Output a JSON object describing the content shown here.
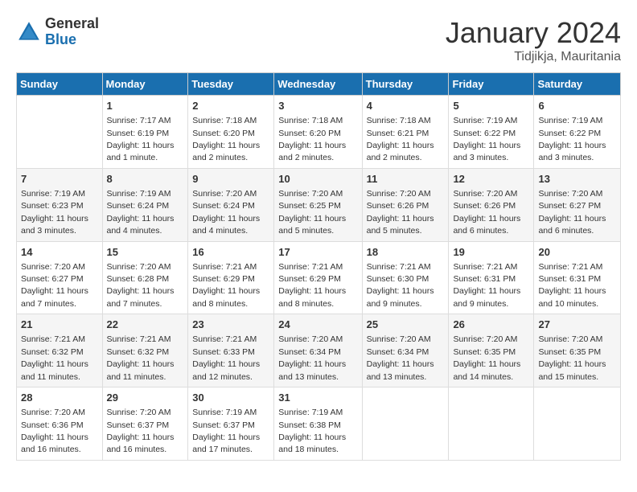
{
  "header": {
    "logo_general": "General",
    "logo_blue": "Blue",
    "month_year": "January 2024",
    "location": "Tidjikja, Mauritania"
  },
  "days_of_week": [
    "Sunday",
    "Monday",
    "Tuesday",
    "Wednesday",
    "Thursday",
    "Friday",
    "Saturday"
  ],
  "weeks": [
    [
      {
        "day": "",
        "sunrise": "",
        "sunset": "",
        "daylight": ""
      },
      {
        "day": "1",
        "sunrise": "Sunrise: 7:17 AM",
        "sunset": "Sunset: 6:19 PM",
        "daylight": "Daylight: 11 hours and 1 minute."
      },
      {
        "day": "2",
        "sunrise": "Sunrise: 7:18 AM",
        "sunset": "Sunset: 6:20 PM",
        "daylight": "Daylight: 11 hours and 2 minutes."
      },
      {
        "day": "3",
        "sunrise": "Sunrise: 7:18 AM",
        "sunset": "Sunset: 6:20 PM",
        "daylight": "Daylight: 11 hours and 2 minutes."
      },
      {
        "day": "4",
        "sunrise": "Sunrise: 7:18 AM",
        "sunset": "Sunset: 6:21 PM",
        "daylight": "Daylight: 11 hours and 2 minutes."
      },
      {
        "day": "5",
        "sunrise": "Sunrise: 7:19 AM",
        "sunset": "Sunset: 6:22 PM",
        "daylight": "Daylight: 11 hours and 3 minutes."
      },
      {
        "day": "6",
        "sunrise": "Sunrise: 7:19 AM",
        "sunset": "Sunset: 6:22 PM",
        "daylight": "Daylight: 11 hours and 3 minutes."
      }
    ],
    [
      {
        "day": "7",
        "sunrise": "Sunrise: 7:19 AM",
        "sunset": "Sunset: 6:23 PM",
        "daylight": "Daylight: 11 hours and 3 minutes."
      },
      {
        "day": "8",
        "sunrise": "Sunrise: 7:19 AM",
        "sunset": "Sunset: 6:24 PM",
        "daylight": "Daylight: 11 hours and 4 minutes."
      },
      {
        "day": "9",
        "sunrise": "Sunrise: 7:20 AM",
        "sunset": "Sunset: 6:24 PM",
        "daylight": "Daylight: 11 hours and 4 minutes."
      },
      {
        "day": "10",
        "sunrise": "Sunrise: 7:20 AM",
        "sunset": "Sunset: 6:25 PM",
        "daylight": "Daylight: 11 hours and 5 minutes."
      },
      {
        "day": "11",
        "sunrise": "Sunrise: 7:20 AM",
        "sunset": "Sunset: 6:26 PM",
        "daylight": "Daylight: 11 hours and 5 minutes."
      },
      {
        "day": "12",
        "sunrise": "Sunrise: 7:20 AM",
        "sunset": "Sunset: 6:26 PM",
        "daylight": "Daylight: 11 hours and 6 minutes."
      },
      {
        "day": "13",
        "sunrise": "Sunrise: 7:20 AM",
        "sunset": "Sunset: 6:27 PM",
        "daylight": "Daylight: 11 hours and 6 minutes."
      }
    ],
    [
      {
        "day": "14",
        "sunrise": "Sunrise: 7:20 AM",
        "sunset": "Sunset: 6:27 PM",
        "daylight": "Daylight: 11 hours and 7 minutes."
      },
      {
        "day": "15",
        "sunrise": "Sunrise: 7:20 AM",
        "sunset": "Sunset: 6:28 PM",
        "daylight": "Daylight: 11 hours and 7 minutes."
      },
      {
        "day": "16",
        "sunrise": "Sunrise: 7:21 AM",
        "sunset": "Sunset: 6:29 PM",
        "daylight": "Daylight: 11 hours and 8 minutes."
      },
      {
        "day": "17",
        "sunrise": "Sunrise: 7:21 AM",
        "sunset": "Sunset: 6:29 PM",
        "daylight": "Daylight: 11 hours and 8 minutes."
      },
      {
        "day": "18",
        "sunrise": "Sunrise: 7:21 AM",
        "sunset": "Sunset: 6:30 PM",
        "daylight": "Daylight: 11 hours and 9 minutes."
      },
      {
        "day": "19",
        "sunrise": "Sunrise: 7:21 AM",
        "sunset": "Sunset: 6:31 PM",
        "daylight": "Daylight: 11 hours and 9 minutes."
      },
      {
        "day": "20",
        "sunrise": "Sunrise: 7:21 AM",
        "sunset": "Sunset: 6:31 PM",
        "daylight": "Daylight: 11 hours and 10 minutes."
      }
    ],
    [
      {
        "day": "21",
        "sunrise": "Sunrise: 7:21 AM",
        "sunset": "Sunset: 6:32 PM",
        "daylight": "Daylight: 11 hours and 11 minutes."
      },
      {
        "day": "22",
        "sunrise": "Sunrise: 7:21 AM",
        "sunset": "Sunset: 6:32 PM",
        "daylight": "Daylight: 11 hours and 11 minutes."
      },
      {
        "day": "23",
        "sunrise": "Sunrise: 7:21 AM",
        "sunset": "Sunset: 6:33 PM",
        "daylight": "Daylight: 11 hours and 12 minutes."
      },
      {
        "day": "24",
        "sunrise": "Sunrise: 7:20 AM",
        "sunset": "Sunset: 6:34 PM",
        "daylight": "Daylight: 11 hours and 13 minutes."
      },
      {
        "day": "25",
        "sunrise": "Sunrise: 7:20 AM",
        "sunset": "Sunset: 6:34 PM",
        "daylight": "Daylight: 11 hours and 13 minutes."
      },
      {
        "day": "26",
        "sunrise": "Sunrise: 7:20 AM",
        "sunset": "Sunset: 6:35 PM",
        "daylight": "Daylight: 11 hours and 14 minutes."
      },
      {
        "day": "27",
        "sunrise": "Sunrise: 7:20 AM",
        "sunset": "Sunset: 6:35 PM",
        "daylight": "Daylight: 11 hours and 15 minutes."
      }
    ],
    [
      {
        "day": "28",
        "sunrise": "Sunrise: 7:20 AM",
        "sunset": "Sunset: 6:36 PM",
        "daylight": "Daylight: 11 hours and 16 minutes."
      },
      {
        "day": "29",
        "sunrise": "Sunrise: 7:20 AM",
        "sunset": "Sunset: 6:37 PM",
        "daylight": "Daylight: 11 hours and 16 minutes."
      },
      {
        "day": "30",
        "sunrise": "Sunrise: 7:19 AM",
        "sunset": "Sunset: 6:37 PM",
        "daylight": "Daylight: 11 hours and 17 minutes."
      },
      {
        "day": "31",
        "sunrise": "Sunrise: 7:19 AM",
        "sunset": "Sunset: 6:38 PM",
        "daylight": "Daylight: 11 hours and 18 minutes."
      },
      {
        "day": "",
        "sunrise": "",
        "sunset": "",
        "daylight": ""
      },
      {
        "day": "",
        "sunrise": "",
        "sunset": "",
        "daylight": ""
      },
      {
        "day": "",
        "sunrise": "",
        "sunset": "",
        "daylight": ""
      }
    ]
  ]
}
